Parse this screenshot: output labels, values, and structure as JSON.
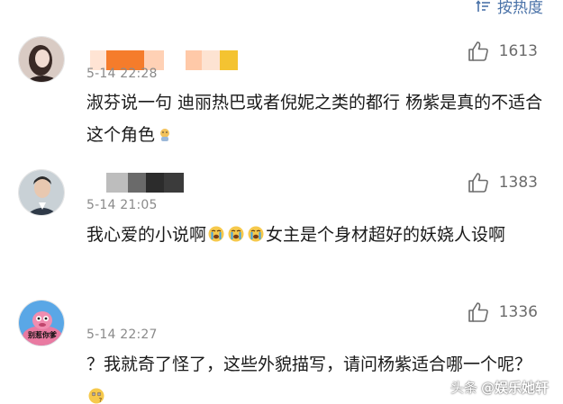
{
  "sort": {
    "label": "按热度",
    "icon": "sort-icon"
  },
  "comments": [
    {
      "time": "5-14 22:28",
      "likes": "1613",
      "text": "淑芬说一句 迪丽热巴或者倪妮之类的都行 杨紫是真的不适合这个角色",
      "avatar_label": ""
    },
    {
      "time": "5-14 21:05",
      "likes": "1383",
      "text_a": "我心爱的小说啊",
      "text_b": "女主是个身材超好的妖娆人设啊",
      "avatar_label": ""
    },
    {
      "time": "5-14 22:27",
      "likes": "1336",
      "text": "？我就奇了怪了，这些外貌描写，请问杨紫适合哪一个呢？",
      "avatar_label": "别惹你爹"
    }
  ],
  "watermark": {
    "prefix": "头条",
    "handle": "@娱乐她轩"
  },
  "colors": {
    "link_blue": "#4a72a8",
    "muted": "#8a8a8a",
    "like_gray": "#6b6b6b",
    "mosaic_orange": "#f57c2b",
    "mosaic_peach": "#ffc9a8",
    "mosaic_yellow": "#f4c331"
  }
}
